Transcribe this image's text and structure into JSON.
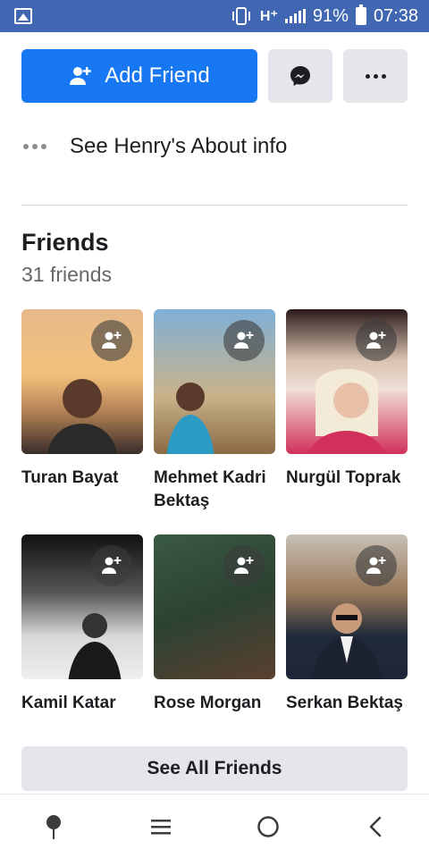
{
  "status_bar": {
    "network": "H⁺",
    "battery": "91%",
    "time": "07:38",
    "icons": [
      "image-icon",
      "vibrate-icon",
      "signal-icon",
      "battery-icon"
    ]
  },
  "actions": {
    "add_friend_label": "Add Friend",
    "messenger_icon": "messenger-icon",
    "more_icon": "more-icon"
  },
  "about": {
    "label": "See Henry's About info"
  },
  "friends": {
    "title": "Friends",
    "count": "31 friends",
    "items": [
      {
        "name": "Turan Bayat"
      },
      {
        "name": "Mehmet Kadri Bektaş"
      },
      {
        "name": "Nurgül Toprak"
      },
      {
        "name": "Kamil Katar"
      },
      {
        "name": "Rose Morgan"
      },
      {
        "name": "Serkan Bektaş"
      }
    ],
    "see_all_label": "See All Friends"
  },
  "nav_bar": {
    "icons": [
      "pin-icon",
      "menu-icon",
      "home-circle-icon",
      "back-icon"
    ]
  },
  "colors": {
    "primary": "#1877f2",
    "status_bar": "#4267b2",
    "button_gray": "#e4e6eb",
    "secondary_text": "#65676b"
  }
}
